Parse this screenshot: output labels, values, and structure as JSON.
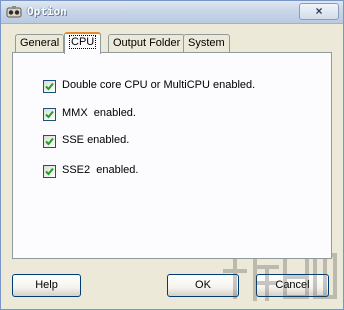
{
  "window": {
    "title": "Option",
    "close_symbol": "×"
  },
  "tabs": [
    {
      "label": "General"
    },
    {
      "label": "CPU"
    },
    {
      "label": "Output Folder"
    },
    {
      "label": "System"
    }
  ],
  "active_tab": "CPU",
  "options": [
    {
      "label": "Double core CPU or MultiCPU enabled.",
      "checked": true
    },
    {
      "label": "MMX  enabled.",
      "checked": true
    },
    {
      "label": "SSE enabled.",
      "checked": true
    },
    {
      "label": "SSE2  enabled.",
      "checked": true
    }
  ],
  "buttons": {
    "help": "Help",
    "ok": "OK",
    "cancel": "Cancel"
  },
  "icons": {
    "app": "app-icon",
    "close": "close-icon",
    "checkmark": "checkmark-icon",
    "watermark": "watermark-logo"
  }
}
